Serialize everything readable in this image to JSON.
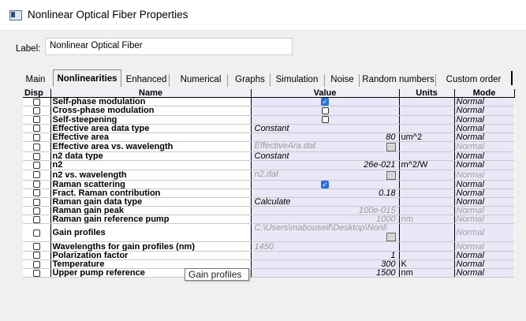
{
  "window": {
    "title": "Nonlinear Optical Fiber Properties"
  },
  "label_field": {
    "caption": "Label:",
    "value": "Nonlinear Optical Fiber"
  },
  "tabs": [
    {
      "label": "Main"
    },
    {
      "label": "Nonlinearities",
      "active": true
    },
    {
      "label": "Enhanced"
    },
    {
      "label": "Numerical"
    },
    {
      "label": "Graphs"
    },
    {
      "label": "Simulation"
    },
    {
      "label": "Noise"
    },
    {
      "label": "Random numbers"
    },
    {
      "label": "Custom order"
    }
  ],
  "grid": {
    "headers": {
      "disp": "Disp",
      "name": "Name",
      "value": "Value",
      "units": "Units",
      "mode": "Mode"
    },
    "rows": [
      {
        "name": "Self-phase modulation",
        "value": "",
        "value_type": "checkbox",
        "checked": true,
        "units": "",
        "mode": "Normal",
        "dim": false
      },
      {
        "name": "Cross-phase modulation",
        "value": "",
        "value_type": "checkbox",
        "checked": false,
        "units": "",
        "mode": "Normal",
        "dim": false
      },
      {
        "name": "Self-steepening",
        "value": "",
        "value_type": "checkbox",
        "checked": false,
        "units": "",
        "mode": "Normal",
        "dim": false
      },
      {
        "name": "Effective area data type",
        "value": "Constant",
        "value_type": "text-left",
        "units": "",
        "mode": "Normal",
        "dim": false
      },
      {
        "name": "Effective area",
        "value": "80",
        "value_type": "text-right",
        "units": "um^2",
        "mode": "Normal",
        "dim": false
      },
      {
        "name": "Effective area vs. wavelength",
        "value": "EffectiveAra.dat",
        "value_type": "file",
        "units": "",
        "mode": "Normal",
        "dim": true
      },
      {
        "name": "n2 data type",
        "value": "Constant",
        "value_type": "text-left",
        "units": "",
        "mode": "Normal",
        "dim": false
      },
      {
        "name": "n2",
        "value": "26e-021",
        "value_type": "text-right",
        "units": "m^2/W",
        "mode": "Normal",
        "dim": false
      },
      {
        "name": "n2 vs. wavelength",
        "value": "n2.dat",
        "value_type": "file",
        "units": "",
        "mode": "Normal",
        "dim": true
      },
      {
        "name": "Raman scattering",
        "value": "",
        "value_type": "checkbox",
        "checked": true,
        "units": "",
        "mode": "Normal",
        "dim": false
      },
      {
        "name": "Fract. Raman contribution",
        "value": "0.18",
        "value_type": "text-right",
        "units": "",
        "mode": "Normal",
        "dim": false
      },
      {
        "name": "Raman gain data type",
        "value": "Calculate",
        "value_type": "text-left",
        "units": "",
        "mode": "Normal",
        "dim": false
      },
      {
        "name": "Raman gain peak",
        "value": "100e-015",
        "value_type": "text-right",
        "units": "",
        "mode": "Normal",
        "dim": true
      },
      {
        "name": "Raman gain reference pump",
        "value": "1000",
        "value_type": "text-right",
        "units": "nm",
        "mode": "Normal",
        "dim": true
      },
      {
        "name": "Gain profiles",
        "value": "C:\\Users\\mabouseif\\Desktop\\Nonli",
        "value_type": "file",
        "units": "",
        "mode": "Normal",
        "dim": true
      },
      {
        "name": "Wavelengths for gain profiles (nm)",
        "value": "1450",
        "value_type": "text-left",
        "units": "",
        "mode": "Normal",
        "dim": true
      },
      {
        "name": "Polarization factor",
        "value": "1",
        "value_type": "text-right",
        "units": "",
        "mode": "Normal",
        "dim": false
      },
      {
        "name": "Temperature",
        "value": "300",
        "value_type": "text-right",
        "units": "K",
        "mode": "Normal",
        "dim": false
      },
      {
        "name": "Upper pump reference",
        "value": "1500",
        "value_type": "text-right",
        "units": "nm",
        "mode": "Normal",
        "dim": false
      }
    ]
  },
  "tooltip": {
    "text": "Gain profiles"
  },
  "icons": {
    "app": "window-app-icon",
    "checkbox": "checkbox-icon",
    "browse": "browse-ellipsis-icon"
  },
  "colors": {
    "value_bg": "#e8e8f8",
    "check_blue": "#2a6fd6",
    "dim_text": "#a0a0a0"
  }
}
